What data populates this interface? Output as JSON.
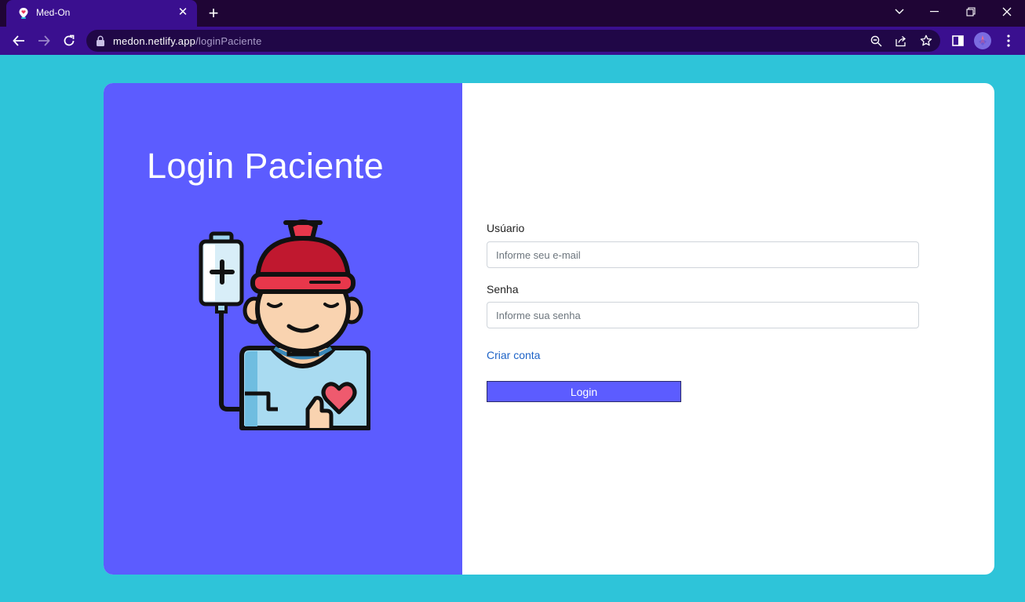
{
  "browser": {
    "tab_title": "Med-On",
    "url_host": "medon.netlify.app",
    "url_path": "/loginPaciente"
  },
  "login": {
    "title": "Login Paciente",
    "username_label": "Usúario",
    "username_placeholder": "Informe seu e-mail",
    "password_label": "Senha",
    "password_placeholder": "Informe sua senha",
    "create_account": "Criar conta",
    "login_button": "Login"
  },
  "colors": {
    "page_background": "#2ec4d9",
    "panel_accent": "#5c5cff",
    "browser_frame": "#3a0f8f",
    "link": "#1e63c7"
  },
  "icons": [
    "med-on-favicon",
    "close-icon",
    "plus-icon",
    "chevron-down-icon",
    "minimize-icon",
    "restore-icon",
    "window-close-icon",
    "back-arrow-icon",
    "forward-arrow-icon",
    "reload-icon",
    "lock-icon",
    "zoom-icon",
    "share-icon",
    "star-icon",
    "side-panel-icon",
    "profile-avatar",
    "kebab-menu-icon",
    "patient-illustration"
  ]
}
